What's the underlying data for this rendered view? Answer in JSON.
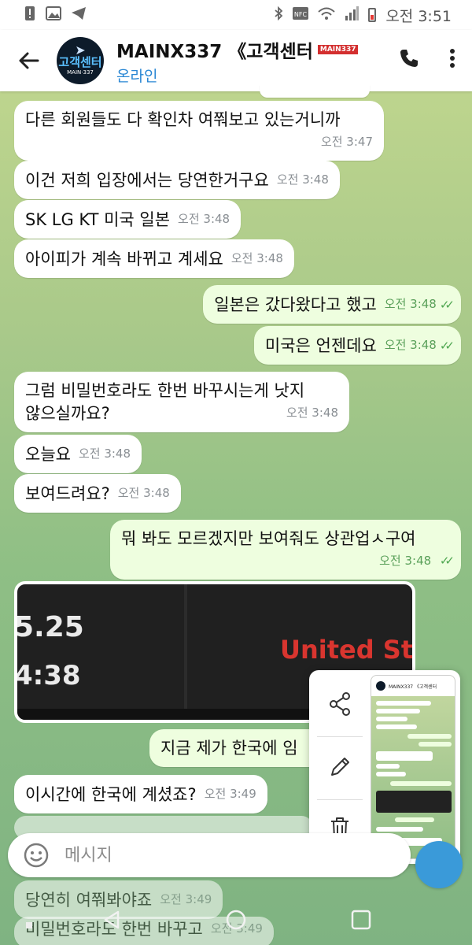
{
  "status_bar": {
    "time": "오전 3:51"
  },
  "header": {
    "title": "MAINX337 《고객센터",
    "status": "온라인",
    "avatar_title": "고객센터",
    "avatar_sub": "MAIN·337",
    "mini_logo": "MAIN337"
  },
  "messages": [
    {
      "dir": "in",
      "text": "다른 회원들도 다 확인차 여쭤보고 있는거니까",
      "time": "오전 3:47"
    },
    {
      "dir": "in",
      "text": "이건 저희 입장에서는 당연한거구요",
      "time": "오전 3:48"
    },
    {
      "dir": "in",
      "text": "SK LG KT 미국 일본",
      "time": "오전 3:48"
    },
    {
      "dir": "in",
      "text": "아이피가 계속 바뀌고 계세요",
      "time": "오전 3:48"
    },
    {
      "dir": "out",
      "text": "일본은 갔다왔다고 했고",
      "time": "오전 3:48"
    },
    {
      "dir": "out",
      "text": "미국은 언젠데요",
      "time": "오전 3:48"
    },
    {
      "dir": "in",
      "text_line1": "그럼 비밀번호라도 한번 바꾸시는게 낫지",
      "text_line2": "않으실까요?",
      "time": "오전 3:48"
    },
    {
      "dir": "in",
      "text": "오늘요",
      "time": "오전 3:48"
    },
    {
      "dir": "in",
      "text": "보여드려요?",
      "time": "오전 3:48"
    },
    {
      "dir": "out",
      "text": "뭐 봐도 모르겠지만 보여줘도 상관업ㅅ구여",
      "time": "오전 3:48"
    },
    {
      "dir": "out",
      "text": "지금 제가 한국에 임",
      "time": ""
    },
    {
      "dir": "in",
      "text": "이시간에 한국에 계셨죠?",
      "time": "오전 3:49"
    },
    {
      "dir": "in",
      "text": "당연히 여쭤봐야죠",
      "time": "오전 3:49"
    },
    {
      "dir": "in",
      "text": "비밀번호라도 한번 바꾸고",
      "time": "오전 3:49"
    }
  ],
  "image_message": {
    "num1": "5.25",
    "num2": "4:38",
    "country": "United Stat"
  },
  "composer": {
    "placeholder": "메시지"
  },
  "colors": {
    "accent": "#3a9ad9",
    "outgoing": "#eefedf",
    "check": "#4ea650"
  }
}
